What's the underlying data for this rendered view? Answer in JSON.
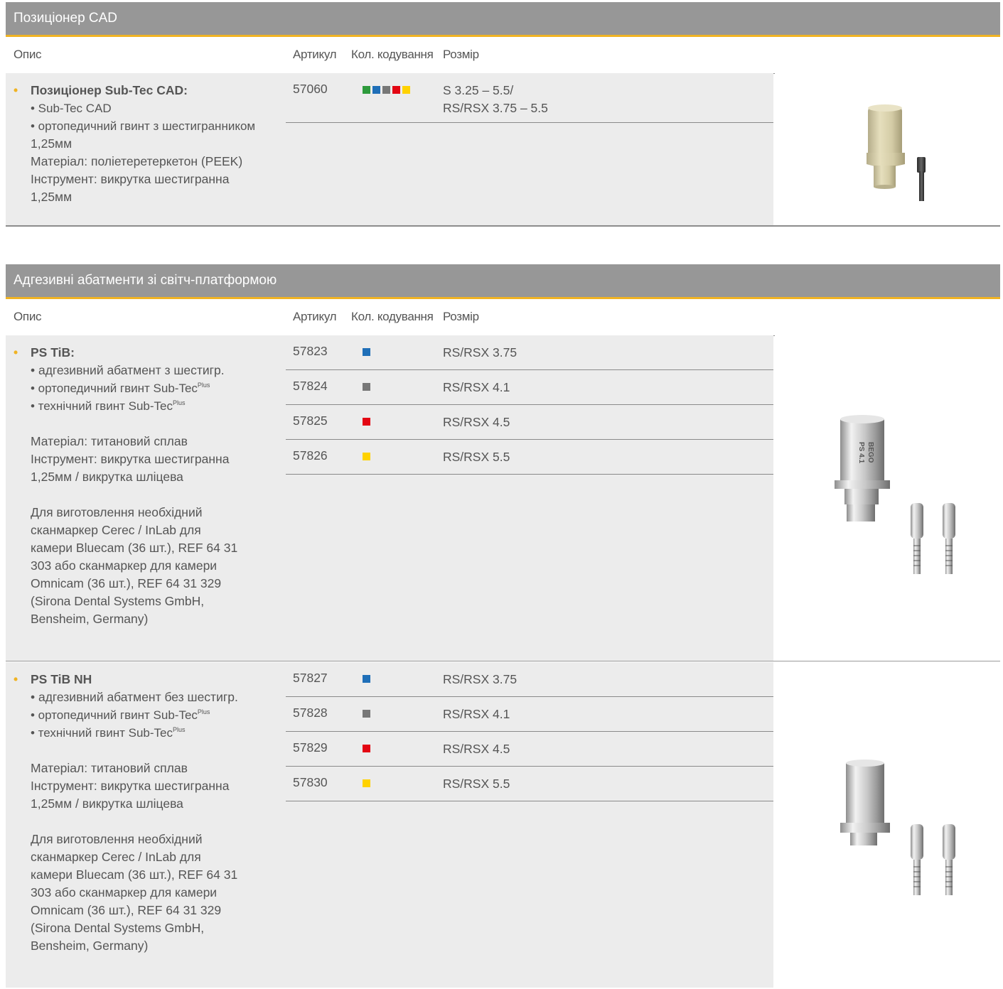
{
  "columns": {
    "desc": "Опис",
    "article": "Артикул",
    "color": "Кол. кодування",
    "size": "Розмір"
  },
  "colors": {
    "green": "#2e9a3c",
    "blue": "#1f6fb8",
    "grey": "#777777",
    "red": "#e30613",
    "yellow": "#ffd200",
    "accent": "#f0b323"
  },
  "section1": {
    "title": "Позиціонер CAD",
    "product": {
      "bullet": "•",
      "name": "Позиціонер Sub-Tec CAD:",
      "items": [
        "• Sub-Tec CAD",
        "• ортопедичний гвинт з шестигранником"
      ],
      "lines": [
        "1,25мм",
        "Матеріал: поліетеретеркетон (PEEK)",
        "Інструмент: викрутка шестигранна",
        "1,25мм"
      ],
      "row": {
        "article": "57060",
        "colors": [
          "green",
          "blue",
          "grey",
          "red",
          "yellow"
        ],
        "size_line1": "S 3.25 – 5.5/",
        "size_line2": "RS/RSX 3.75 – 5.5"
      }
    }
  },
  "section2": {
    "title": "Адгезивні абатменти зі світч-платформою",
    "products": [
      {
        "bullet": "•",
        "name": "PS TiB:",
        "item1": "• адгезивний абатмент з шестигр.",
        "item2": "• ортопедичний гвинт Sub-Tec",
        "item3": "• технічний гвинт Sub-Tec",
        "sup": "Plus",
        "material": "Матеріал: титановий сплав",
        "tool1": "Інструмент: викрутка шестигранна",
        "tool2": "1,25мм / викрутка шліцева",
        "note": [
          "Для виготовлення необхідний",
          "сканмаркер Cerec /  InLab для",
          "камери Bluecam (36 шт.), REF 64 31",
          "303 або сканмаркер для камери",
          "Omnicam (36 шт.), REF 64 31 329",
          "(Sirona Dental Systems GmbH,",
          "Bensheim, Germany)"
        ],
        "rows": [
          {
            "article": "57823",
            "color": "blue",
            "size": "RS/RSX 3.75"
          },
          {
            "article": "57824",
            "color": "grey",
            "size": "RS/RSX 4.1"
          },
          {
            "article": "57825",
            "color": "red",
            "size": "RS/RSX 4.5"
          },
          {
            "article": "57826",
            "color": "yellow",
            "size": "RS/RSX 5.5"
          }
        ],
        "engraving": [
          "BEGO",
          "PS 4.1"
        ]
      },
      {
        "bullet": "•",
        "name": "PS TiB NH",
        "item1": "• адгезивний абатмент без шестигр.",
        "item2": "• ортопедичний гвинт Sub-Tec",
        "item3": "• технічний гвинт Sub-Tec",
        "sup": "Plus",
        "material": "Матеріал: титановий сплав",
        "tool1": "Інструмент: викрутка шестигранна",
        "tool2": "1,25мм / викрутка шліцева",
        "note": [
          "Для виготовлення необхідний",
          "сканмаркер Cerec /  InLab для",
          "камери Bluecam (36 шт.), REF 64 31",
          "303 або сканмаркер для камери",
          "Omnicam (36 шт.), REF 64 31 329",
          "(Sirona Dental Systems GmbH,",
          "Bensheim, Germany)"
        ],
        "rows": [
          {
            "article": "57827",
            "color": "blue",
            "size": "RS/RSX 3.75"
          },
          {
            "article": "57828",
            "color": "grey",
            "size": "RS/RSX 4.1"
          },
          {
            "article": "57829",
            "color": "red",
            "size": "RS/RSX 4.5"
          },
          {
            "article": "57830",
            "color": "yellow",
            "size": "RS/RSX 5.5"
          }
        ]
      }
    ]
  }
}
